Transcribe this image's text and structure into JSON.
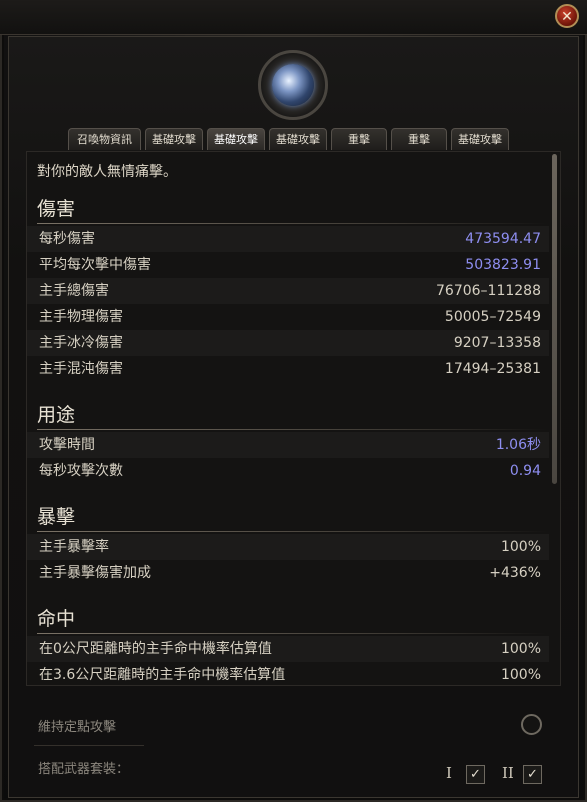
{
  "window": {
    "close_glyph": "✕"
  },
  "tabs": [
    {
      "label": "召喚物資訊",
      "active": false
    },
    {
      "label": "基礎攻擊",
      "active": false
    },
    {
      "label": "基礎攻擊",
      "active": true
    },
    {
      "label": "基礎攻擊",
      "active": false
    },
    {
      "label": "重擊",
      "active": false
    },
    {
      "label": "重擊",
      "active": false
    },
    {
      "label": "基礎攻擊",
      "active": false
    }
  ],
  "panel": {
    "intro": "對你的敵人無情痛擊。",
    "sections": [
      {
        "title": "傷害",
        "rows": [
          {
            "label": "每秒傷害",
            "value": "473594.47",
            "highlight": true
          },
          {
            "label": "平均每次擊中傷害",
            "value": "503823.91",
            "highlight": true
          },
          {
            "label": "主手總傷害",
            "value": "76706–111288",
            "highlight": false
          },
          {
            "label": "主手物理傷害",
            "value": "50005–72549",
            "highlight": false
          },
          {
            "label": "主手冰冷傷害",
            "value": "9207–13358",
            "highlight": false
          },
          {
            "label": "主手混沌傷害",
            "value": "17494–25381",
            "highlight": false
          }
        ]
      },
      {
        "title": "用途",
        "rows": [
          {
            "label": "攻擊時間",
            "value": "1.06秒",
            "highlight": true
          },
          {
            "label": "每秒攻擊次數",
            "value": "0.94",
            "highlight": true
          }
        ]
      },
      {
        "title": "暴擊",
        "rows": [
          {
            "label": "主手暴擊率",
            "value": "100%",
            "highlight": false
          },
          {
            "label": "主手暴擊傷害加成",
            "value": "+436%",
            "highlight": false
          }
        ]
      },
      {
        "title": "命中",
        "rows": [
          {
            "label": "在0公尺距離時的主手命中機率估算值",
            "value": "100%",
            "highlight": false
          },
          {
            "label": "在3.6公尺距離時的主手命中機率估算值",
            "value": "100%",
            "highlight": false
          }
        ]
      }
    ]
  },
  "bottom": {
    "hold_attack_label": "維持定點攻擊",
    "weapon_set_label": "搭配武器套裝：",
    "set_one": "I",
    "set_two": "II",
    "check_glyph": "✓"
  },
  "colors": {
    "highlight_value": "#8e8ef0",
    "text": "#d6d0c2",
    "close_red": "#c9402b"
  },
  "icons": [
    "close-icon",
    "skill-emblem-icon",
    "checkmark-icon",
    "radio-toggle-icon"
  ]
}
